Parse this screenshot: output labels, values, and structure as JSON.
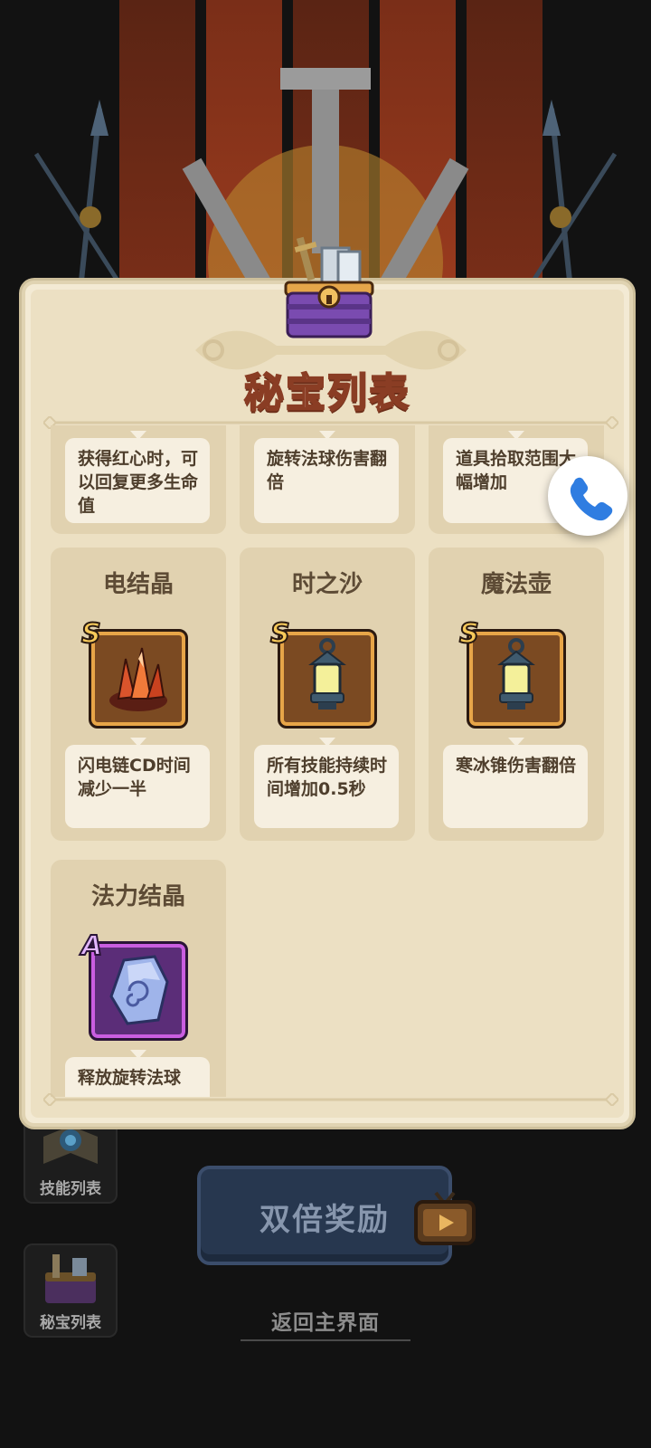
{
  "modal": {
    "title": "秘宝列表"
  },
  "treasures_partial": [
    {
      "desc": "获得红心时，可以回复更多生命值"
    },
    {
      "desc": "旋转法球伤害翻倍"
    },
    {
      "desc": "道具拾取范围大幅增加"
    }
  ],
  "treasures": [
    {
      "name": "电结晶",
      "grade": "S",
      "icon": "red-crystal-icon",
      "desc": "闪电链CD时间减少一半"
    },
    {
      "name": "时之沙",
      "grade": "S",
      "icon": "lantern-icon",
      "desc": "所有技能持续时间增加0.5秒"
    },
    {
      "name": "魔法壶",
      "grade": "S",
      "icon": "lantern-icon",
      "desc": "寒冰锥伤害翻倍"
    },
    {
      "name": "法力结晶",
      "grade": "A",
      "icon": "spiral-rune-stone-icon",
      "desc": "释放旋转法球"
    }
  ],
  "side_menu": {
    "skills_label": "技能列表",
    "treasures_label": "秘宝列表"
  },
  "actions": {
    "double_reward_label": "双倍奖励",
    "back_label": "返回主界面"
  },
  "colors": {
    "modal_bg": "#f3ead4",
    "card_bg": "#e1d2b0",
    "title_stroke": "#8a3d24",
    "s_grade": "#f7c95a",
    "a_grade": "#c95ee0",
    "call_icon": "#2f7de1"
  }
}
